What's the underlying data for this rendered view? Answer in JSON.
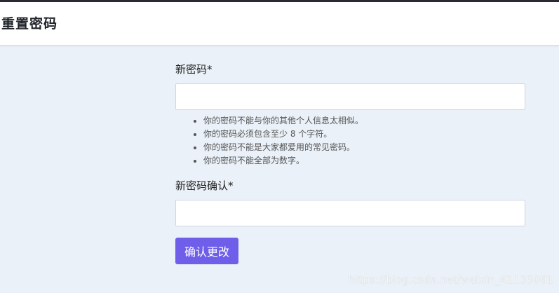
{
  "header": {
    "title": "重置密码"
  },
  "form": {
    "new_password_label": "新密码*",
    "new_password_value": "",
    "help_items": [
      "你的密码不能与你的其他个人信息太相似。",
      "你的密码必须包含至少 8 个字符。",
      "你的密码不能是大家都爱用的常见密码。",
      "你的密码不能全部为数字。"
    ],
    "confirm_password_label": "新密码确认*",
    "confirm_password_value": "",
    "submit_label": "确认更改"
  },
  "watermark": {
    "text": "https://blog.csdn.net/weixin_41133061"
  },
  "colors": {
    "accent": "#6f5ee9",
    "background": "#eaf1f8"
  }
}
